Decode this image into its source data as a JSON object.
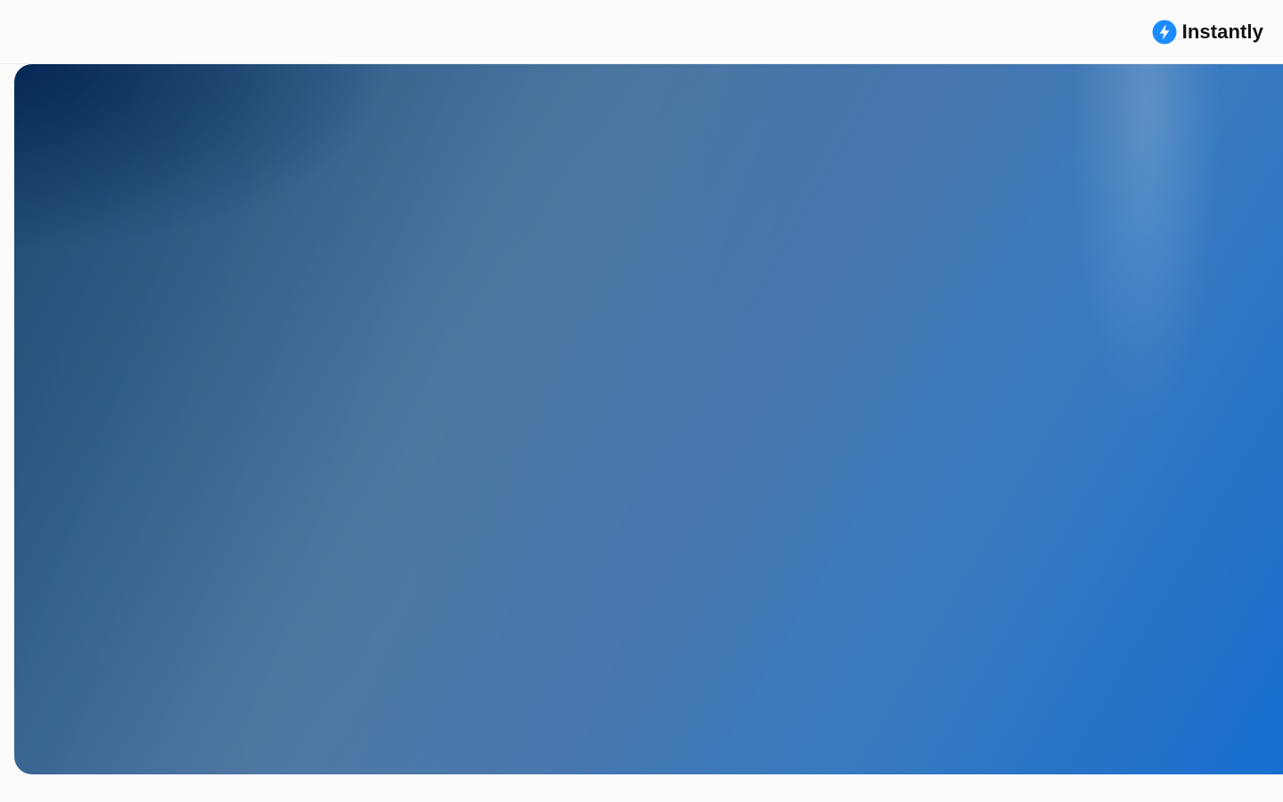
{
  "header": {
    "brand_name": "Instantly",
    "brand_icon": "lightning-bolt-icon",
    "brand_icon_color": "#1b8cff"
  },
  "hero": {
    "background_colors": [
      "#1f4671",
      "#4a7cb6",
      "#166fd0"
    ]
  }
}
